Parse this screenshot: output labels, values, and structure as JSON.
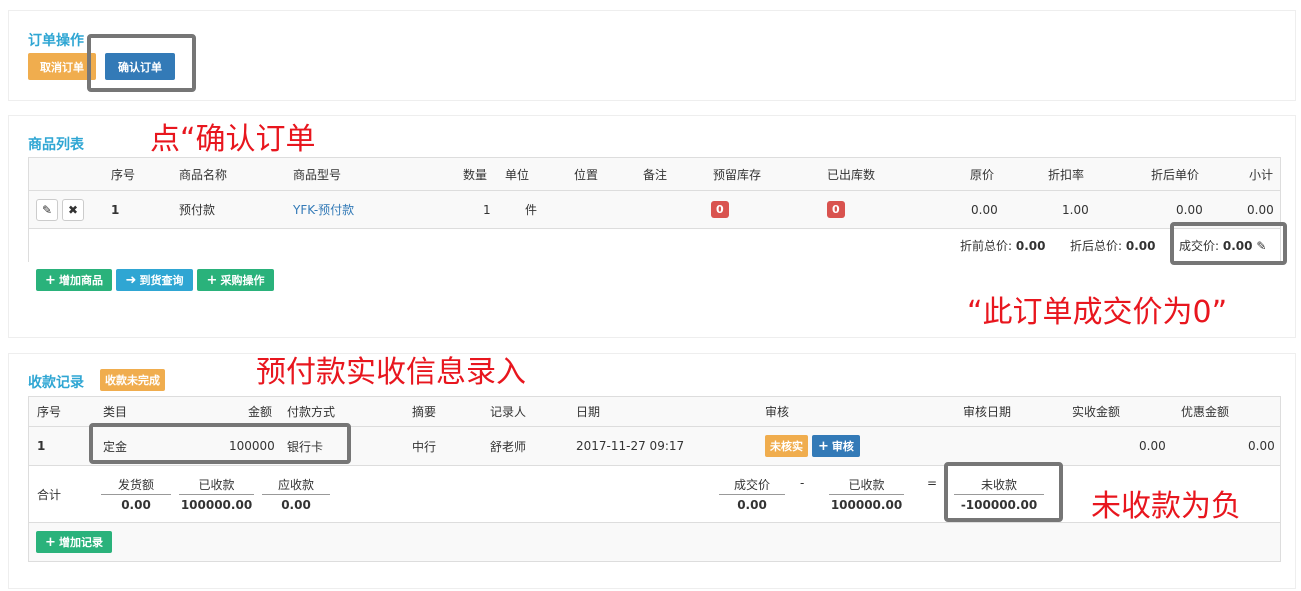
{
  "order_ops": {
    "title": "订单操作",
    "cancel_label": "取消订单",
    "confirm_label": "确认订单"
  },
  "product_list": {
    "title": "商品列表",
    "columns": [
      "序号",
      "商品名称",
      "商品型号",
      "数量",
      "单位",
      "位置",
      "备注",
      "预留库存",
      "已出库数",
      "原价",
      "折扣率",
      "折后单价",
      "小计"
    ],
    "row": {
      "index": "1",
      "name": "预付款",
      "model": "YFK-预付款",
      "qty": "1",
      "unit": "件",
      "reserved": "0",
      "shipped": "0",
      "price": "0.00",
      "discount": "1.00",
      "unit_after": "0.00",
      "subtotal": "0.00"
    },
    "totals": {
      "before_label": "折前总价:",
      "before_value": "0.00",
      "after_label": "折后总价:",
      "after_value": "0.00",
      "deal_label": "成交价:",
      "deal_value": "0.00"
    },
    "buttons": {
      "add": "增加商品",
      "arrival": "到货查询",
      "purchase": "采购操作"
    }
  },
  "payments": {
    "title": "收款记录",
    "status_badge": "收款未完成",
    "columns": [
      "序号",
      "类目",
      "金额",
      "付款方式",
      "摘要",
      "记录人",
      "日期",
      "审核",
      "审核日期",
      "实收金额",
      "优惠金额"
    ],
    "row": {
      "index": "1",
      "category": "定金",
      "amount": "100000",
      "method": "银行卡",
      "summary": "中行",
      "recorder": "舒老师",
      "date": "2017-11-27 09:17",
      "unverified": "未核实",
      "audit_btn": "审核",
      "received": "0.00",
      "discount": "0.00"
    },
    "summary": {
      "label": "合计",
      "shipped_label": "发货额",
      "shipped_value": "0.00",
      "received_label": "已收款",
      "received_value": "100000.00",
      "due_label": "应收款",
      "due_value": "0.00",
      "deal_label": "成交价",
      "deal_value": "0.00",
      "minus": "-",
      "received2_label": "已收款",
      "received2_value": "100000.00",
      "equals": "=",
      "outstanding_label": "未收款",
      "outstanding_value": "-100000.00"
    },
    "add_record": "增加记录"
  },
  "annotations": {
    "a1": "点“确认订单",
    "a2": "“此订单成交价为0”",
    "a3": "预付款实收信息录入",
    "a4": "未收款为负"
  }
}
